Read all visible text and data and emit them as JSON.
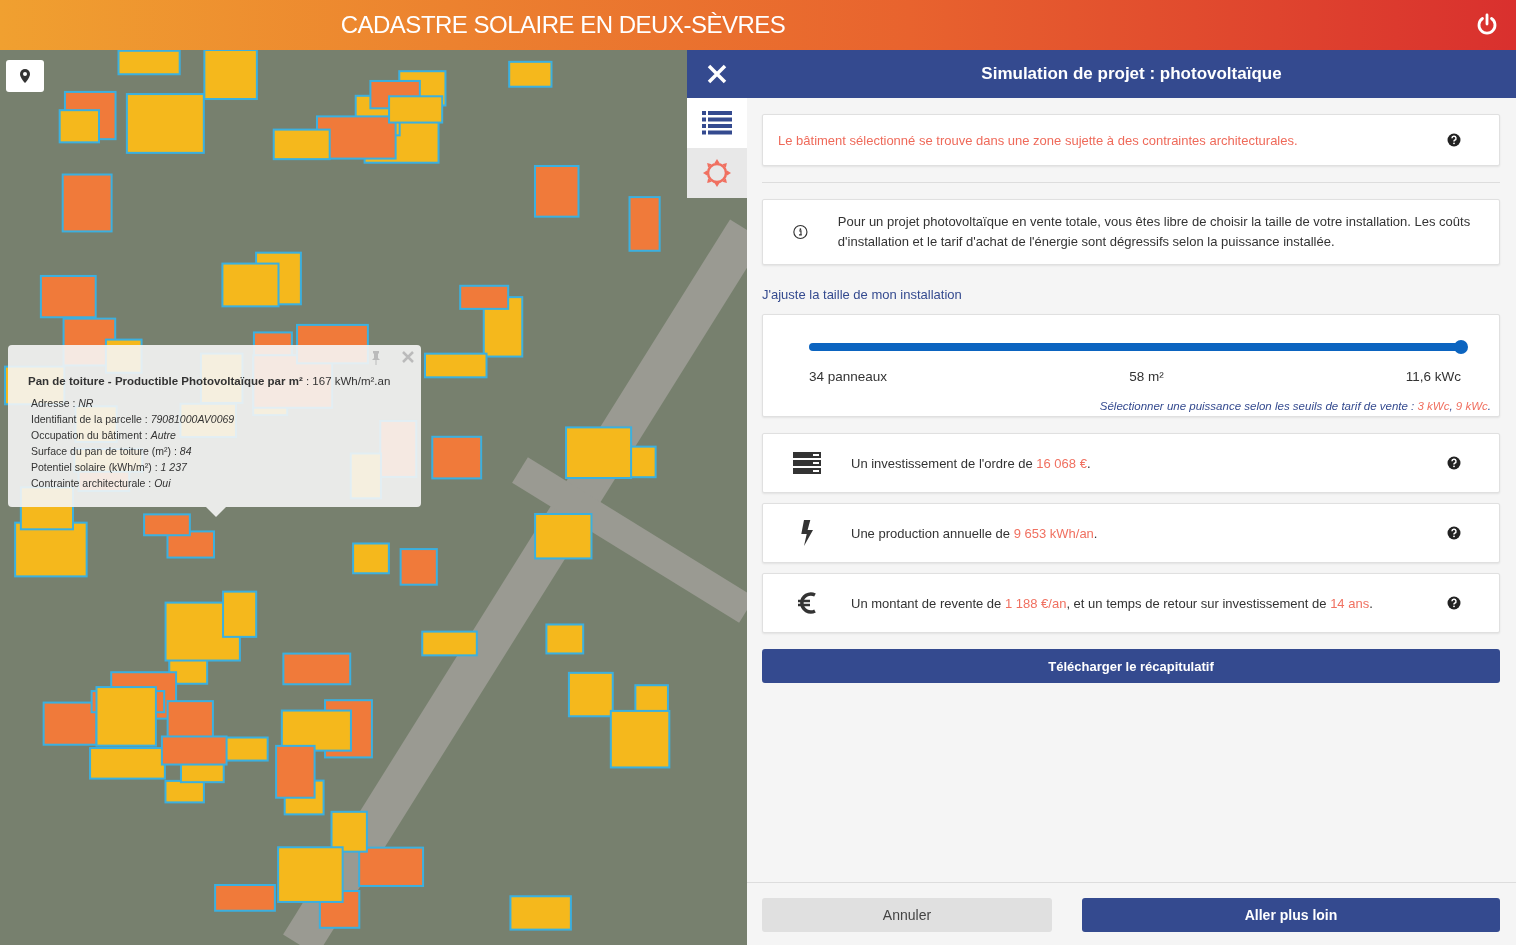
{
  "header": {
    "title": "CADASTRE SOLAIRE EN DEUX-SÈVRES"
  },
  "popup": {
    "heading": "**Pan de toiture - Productible Photovoltaïque par m²** : 167 kWh/m².an",
    "fields": [
      "Adresse : *NR*",
      "Identifiant de la parcelle : *79081000AV0069*",
      "Occupation du bâtiment : *Autre*",
      "Surface du pan de toiture (m²) : *84*",
      "Potentiel solaire (kWh/m²) : *1 237*",
      "Contrainte architecturale : *Oui*"
    ]
  },
  "panel": {
    "title": "Simulation de projet : photovoltaïque",
    "tabs": [
      {
        "kind": "list",
        "selected": true
      },
      {
        "kind": "sun",
        "selected": false
      }
    ],
    "alert": "Le bâtiment sélectionné se trouve dans une zone sujette à des contraintes architecturales.",
    "info": "Pour un projet photovoltaïque en vente totale, vous êtes libre de choisir la taille de votre installation. Les coûts d'installation et le tarif d'achat de l'énergie sont dégressifs selon la puissance installée.",
    "slider_label": "J'ajuste la taille de mon installation",
    "slider": {
      "level": 1,
      "readings": [
        "34 panneaux",
        "58 m²",
        "11,6 kWc"
      ],
      "hint": [
        {
          "text": "Sélectionner une puissance selon les seuils de tarif de vente : ",
          "highlight": false
        },
        {
          "text": "3 kWc",
          "highlight": true
        },
        {
          "text": ", ",
          "highlight": false
        },
        {
          "text": "9 kWc",
          "highlight": true
        },
        {
          "text": ".",
          "highlight": false
        }
      ]
    },
    "results": [
      {
        "kind": "invest",
        "parts": [
          {
            "text": "Un investissement de l'ordre de ",
            "highlight": false
          },
          {
            "text": "16 068 €",
            "highlight": true
          },
          {
            "text": ".",
            "highlight": false
          }
        ]
      },
      {
        "kind": "production",
        "parts": [
          {
            "text": "Une production annuelle de ",
            "highlight": false
          },
          {
            "text": "9 653 kWh/an",
            "highlight": true
          },
          {
            "text": ".",
            "highlight": false
          }
        ]
      },
      {
        "kind": "resale",
        "parts": [
          {
            "text": "Un montant de revente de ",
            "highlight": false
          },
          {
            "text": "1 188 €/an",
            "highlight": true
          },
          {
            "text": ", et un temps de retour sur investissement de ",
            "highlight": false
          },
          {
            "text": "14 ans",
            "highlight": true
          },
          {
            "text": ".",
            "highlight": false
          }
        ]
      }
    ],
    "download_button": "Télécharger le récapitulatif",
    "cancel_button": "Annuler",
    "next_button": "Aller plus loin"
  }
}
